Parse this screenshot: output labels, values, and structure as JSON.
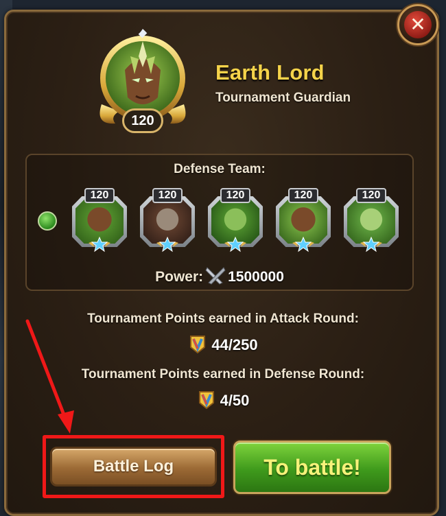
{
  "hero": {
    "name": "Earth Lord",
    "title": "Tournament Guardian",
    "level": "120"
  },
  "defense": {
    "label": "Defense Team:",
    "team": [
      {
        "level": "120",
        "portrait": "hero-portrait-1"
      },
      {
        "level": "120",
        "portrait": "hero-portrait-2"
      },
      {
        "level": "120",
        "portrait": "hero-portrait-3"
      },
      {
        "level": "120",
        "portrait": "hero-portrait-4"
      },
      {
        "level": "120",
        "portrait": "hero-portrait-5"
      }
    ],
    "power_label": "Power:",
    "power_value": "1500000"
  },
  "points": {
    "attack_label": "Tournament Points earned in Attack Round:",
    "attack_value": "44/250",
    "defense_label": "Tournament Points earned in Defense Round:",
    "defense_value": "4/50"
  },
  "buttons": {
    "battle_log": "Battle Log",
    "to_battle": "To battle!"
  },
  "icons": [
    "close-icon",
    "element-icon",
    "swords-icon",
    "tournament-points-icon",
    "star-icon"
  ],
  "colors": {
    "accent_gold": "#f5d34a",
    "panel": "#2b1f14",
    "battle_green": "#3f9a1c",
    "highlight_red": "#f01818"
  }
}
